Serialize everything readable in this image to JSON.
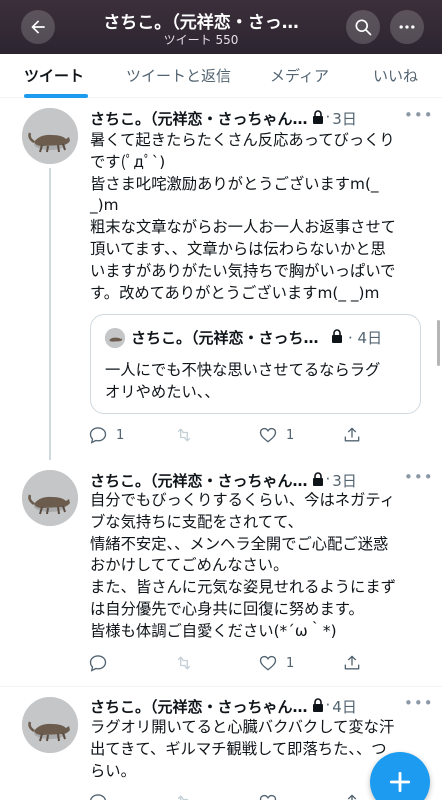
{
  "header": {
    "title": "さちこ。（元祥恋・さっ…",
    "subtitle": "ツイート 550"
  },
  "tabs": [
    {
      "label": "ツイート",
      "active": true
    },
    {
      "label": "ツイートと返信",
      "active": false
    },
    {
      "label": "メディア",
      "active": false
    },
    {
      "label": "いいね",
      "active": false
    }
  ],
  "tweets": [
    {
      "name": "さちこ。（元祥恋・さっちゃん…",
      "date": "3日",
      "lines": [
        "暑くて起きたらたくさん反応あってびっくり",
        "です(ﾟдﾟ`)",
        "皆さま叱咤激励ありがとうございますm(_",
        "_)m",
        "粗末な文章ながらお一人お一人お返事させて",
        "頂いてます、、文章からは伝わらないかと思",
        "いますがありがたい気持ちで胸がいっぱいで",
        "す。改めてありがとうございますm(_ _)m"
      ],
      "quote": {
        "name": "さちこ。（元祥恋・さっち…",
        "date": "4日",
        "lines": [
          "一人にでも不快な思いさせてるならラグ",
          "オリやめたい、、"
        ]
      },
      "replies": "1",
      "retweets": "",
      "likes": "1"
    },
    {
      "name": "さちこ。（元祥恋・さっちゃん…",
      "date": "3日",
      "lines": [
        "自分でもびっくりするくらい、今はネガティ",
        "ブな気持ちに支配をされてて、",
        "情緒不安定、、メンヘラ全開でご心配ご迷惑",
        "おかけしててごめんなさい。",
        "また、皆さんに元気な姿見せれるようにまず",
        "は自分優先で心身共に回復に努めます。",
        "皆様も体調ご自愛ください(*´ω｀*)"
      ],
      "replies": "",
      "retweets": "",
      "likes": "1"
    },
    {
      "name": "さちこ。（元祥恋・さっちゃん…",
      "date": "4日",
      "lines": [
        "ラグオリ開いてると心臓バクバクして変な汗",
        "出てきて、ギルマチ観戦して即落ちた、、つ",
        "らい。"
      ]
    }
  ],
  "icons": {
    "back": "arrow-left-icon",
    "search": "search-icon",
    "more": "more-horizontal-icon",
    "lock": "lock-icon",
    "reply": "reply-icon",
    "retweet": "retweet-icon",
    "like": "heart-icon",
    "share": "share-icon",
    "compose": "plus-icon"
  },
  "colors": {
    "accent": "#1d9bf0",
    "header_bg": "#3b2f3a",
    "secondary_text": "#536471"
  }
}
